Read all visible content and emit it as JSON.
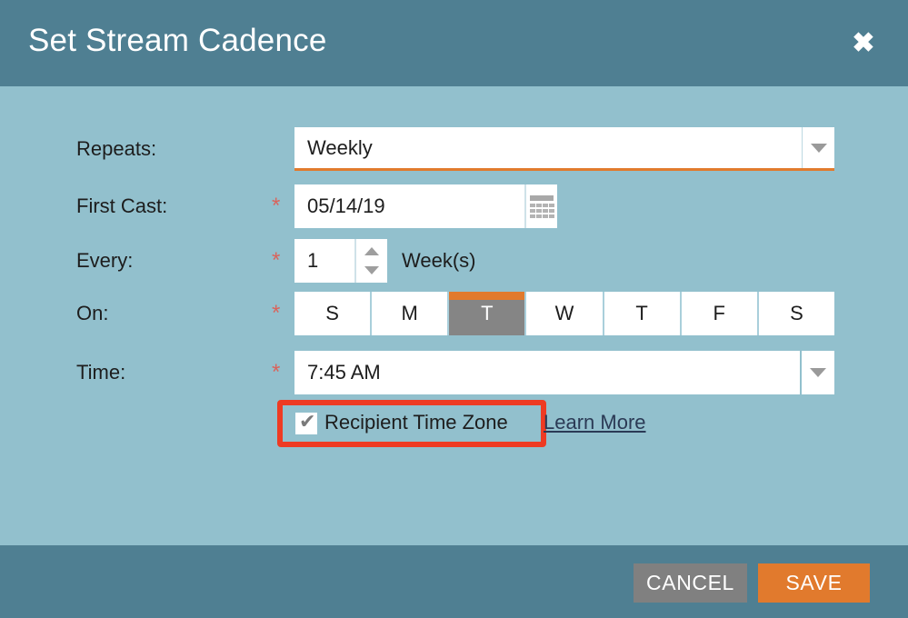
{
  "dialog": {
    "title": "Set Stream Cadence",
    "close_icon": "close-x-icon"
  },
  "colors": {
    "header_bg": "#4f7f92",
    "body_bg": "#92c0cd",
    "accent_orange": "#e17a2d",
    "highlight_red": "#ee3b23",
    "required_star": "#d9645c",
    "selected_day": "#858585",
    "cancel_gray": "#808080"
  },
  "form": {
    "repeats": {
      "label": "Repeats:",
      "value": "Weekly",
      "required": false,
      "arrow_icon": "chevron-down-icon"
    },
    "first_cast": {
      "label": "First Cast:",
      "value": "05/14/19",
      "required": true,
      "star": "*",
      "calendar_icon": "calendar-icon"
    },
    "every": {
      "label": "Every:",
      "value": "1",
      "required": true,
      "star": "*",
      "unit": "Week(s)",
      "spinner_up_icon": "spinner-up-icon",
      "spinner_down_icon": "spinner-down-icon"
    },
    "on": {
      "label": "On:",
      "required": true,
      "star": "*",
      "days": [
        {
          "label": "S",
          "selected": false
        },
        {
          "label": "M",
          "selected": false
        },
        {
          "label": "T",
          "selected": true
        },
        {
          "label": "W",
          "selected": false
        },
        {
          "label": "T",
          "selected": false
        },
        {
          "label": "F",
          "selected": false
        },
        {
          "label": "S",
          "selected": false
        }
      ]
    },
    "time": {
      "label": "Time:",
      "value": "7:45 AM",
      "required": true,
      "star": "*",
      "arrow_icon": "chevron-down-icon"
    },
    "recipient_time_zone": {
      "label": "Recipient Time Zone",
      "checked": true,
      "check_glyph": "✔",
      "learn_more": "Learn More"
    }
  },
  "footer": {
    "cancel_label": "CANCEL",
    "save_label": "SAVE"
  }
}
